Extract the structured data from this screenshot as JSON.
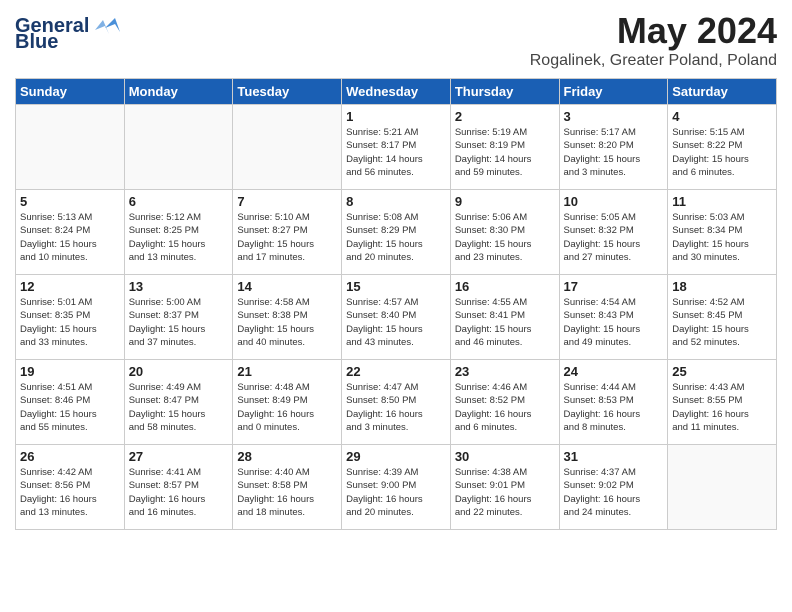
{
  "header": {
    "logo_line1": "General",
    "logo_line2": "Blue",
    "month_title": "May 2024",
    "location": "Rogalinek, Greater Poland, Poland"
  },
  "weekdays": [
    "Sunday",
    "Monday",
    "Tuesday",
    "Wednesday",
    "Thursday",
    "Friday",
    "Saturday"
  ],
  "weeks": [
    [
      {
        "day": "",
        "info": ""
      },
      {
        "day": "",
        "info": ""
      },
      {
        "day": "",
        "info": ""
      },
      {
        "day": "1",
        "info": "Sunrise: 5:21 AM\nSunset: 8:17 PM\nDaylight: 14 hours\nand 56 minutes."
      },
      {
        "day": "2",
        "info": "Sunrise: 5:19 AM\nSunset: 8:19 PM\nDaylight: 14 hours\nand 59 minutes."
      },
      {
        "day": "3",
        "info": "Sunrise: 5:17 AM\nSunset: 8:20 PM\nDaylight: 15 hours\nand 3 minutes."
      },
      {
        "day": "4",
        "info": "Sunrise: 5:15 AM\nSunset: 8:22 PM\nDaylight: 15 hours\nand 6 minutes."
      }
    ],
    [
      {
        "day": "5",
        "info": "Sunrise: 5:13 AM\nSunset: 8:24 PM\nDaylight: 15 hours\nand 10 minutes."
      },
      {
        "day": "6",
        "info": "Sunrise: 5:12 AM\nSunset: 8:25 PM\nDaylight: 15 hours\nand 13 minutes."
      },
      {
        "day": "7",
        "info": "Sunrise: 5:10 AM\nSunset: 8:27 PM\nDaylight: 15 hours\nand 17 minutes."
      },
      {
        "day": "8",
        "info": "Sunrise: 5:08 AM\nSunset: 8:29 PM\nDaylight: 15 hours\nand 20 minutes."
      },
      {
        "day": "9",
        "info": "Sunrise: 5:06 AM\nSunset: 8:30 PM\nDaylight: 15 hours\nand 23 minutes."
      },
      {
        "day": "10",
        "info": "Sunrise: 5:05 AM\nSunset: 8:32 PM\nDaylight: 15 hours\nand 27 minutes."
      },
      {
        "day": "11",
        "info": "Sunrise: 5:03 AM\nSunset: 8:34 PM\nDaylight: 15 hours\nand 30 minutes."
      }
    ],
    [
      {
        "day": "12",
        "info": "Sunrise: 5:01 AM\nSunset: 8:35 PM\nDaylight: 15 hours\nand 33 minutes."
      },
      {
        "day": "13",
        "info": "Sunrise: 5:00 AM\nSunset: 8:37 PM\nDaylight: 15 hours\nand 37 minutes."
      },
      {
        "day": "14",
        "info": "Sunrise: 4:58 AM\nSunset: 8:38 PM\nDaylight: 15 hours\nand 40 minutes."
      },
      {
        "day": "15",
        "info": "Sunrise: 4:57 AM\nSunset: 8:40 PM\nDaylight: 15 hours\nand 43 minutes."
      },
      {
        "day": "16",
        "info": "Sunrise: 4:55 AM\nSunset: 8:41 PM\nDaylight: 15 hours\nand 46 minutes."
      },
      {
        "day": "17",
        "info": "Sunrise: 4:54 AM\nSunset: 8:43 PM\nDaylight: 15 hours\nand 49 minutes."
      },
      {
        "day": "18",
        "info": "Sunrise: 4:52 AM\nSunset: 8:45 PM\nDaylight: 15 hours\nand 52 minutes."
      }
    ],
    [
      {
        "day": "19",
        "info": "Sunrise: 4:51 AM\nSunset: 8:46 PM\nDaylight: 15 hours\nand 55 minutes."
      },
      {
        "day": "20",
        "info": "Sunrise: 4:49 AM\nSunset: 8:47 PM\nDaylight: 15 hours\nand 58 minutes."
      },
      {
        "day": "21",
        "info": "Sunrise: 4:48 AM\nSunset: 8:49 PM\nDaylight: 16 hours\nand 0 minutes."
      },
      {
        "day": "22",
        "info": "Sunrise: 4:47 AM\nSunset: 8:50 PM\nDaylight: 16 hours\nand 3 minutes."
      },
      {
        "day": "23",
        "info": "Sunrise: 4:46 AM\nSunset: 8:52 PM\nDaylight: 16 hours\nand 6 minutes."
      },
      {
        "day": "24",
        "info": "Sunrise: 4:44 AM\nSunset: 8:53 PM\nDaylight: 16 hours\nand 8 minutes."
      },
      {
        "day": "25",
        "info": "Sunrise: 4:43 AM\nSunset: 8:55 PM\nDaylight: 16 hours\nand 11 minutes."
      }
    ],
    [
      {
        "day": "26",
        "info": "Sunrise: 4:42 AM\nSunset: 8:56 PM\nDaylight: 16 hours\nand 13 minutes."
      },
      {
        "day": "27",
        "info": "Sunrise: 4:41 AM\nSunset: 8:57 PM\nDaylight: 16 hours\nand 16 minutes."
      },
      {
        "day": "28",
        "info": "Sunrise: 4:40 AM\nSunset: 8:58 PM\nDaylight: 16 hours\nand 18 minutes."
      },
      {
        "day": "29",
        "info": "Sunrise: 4:39 AM\nSunset: 9:00 PM\nDaylight: 16 hours\nand 20 minutes."
      },
      {
        "day": "30",
        "info": "Sunrise: 4:38 AM\nSunset: 9:01 PM\nDaylight: 16 hours\nand 22 minutes."
      },
      {
        "day": "31",
        "info": "Sunrise: 4:37 AM\nSunset: 9:02 PM\nDaylight: 16 hours\nand 24 minutes."
      },
      {
        "day": "",
        "info": ""
      }
    ]
  ]
}
